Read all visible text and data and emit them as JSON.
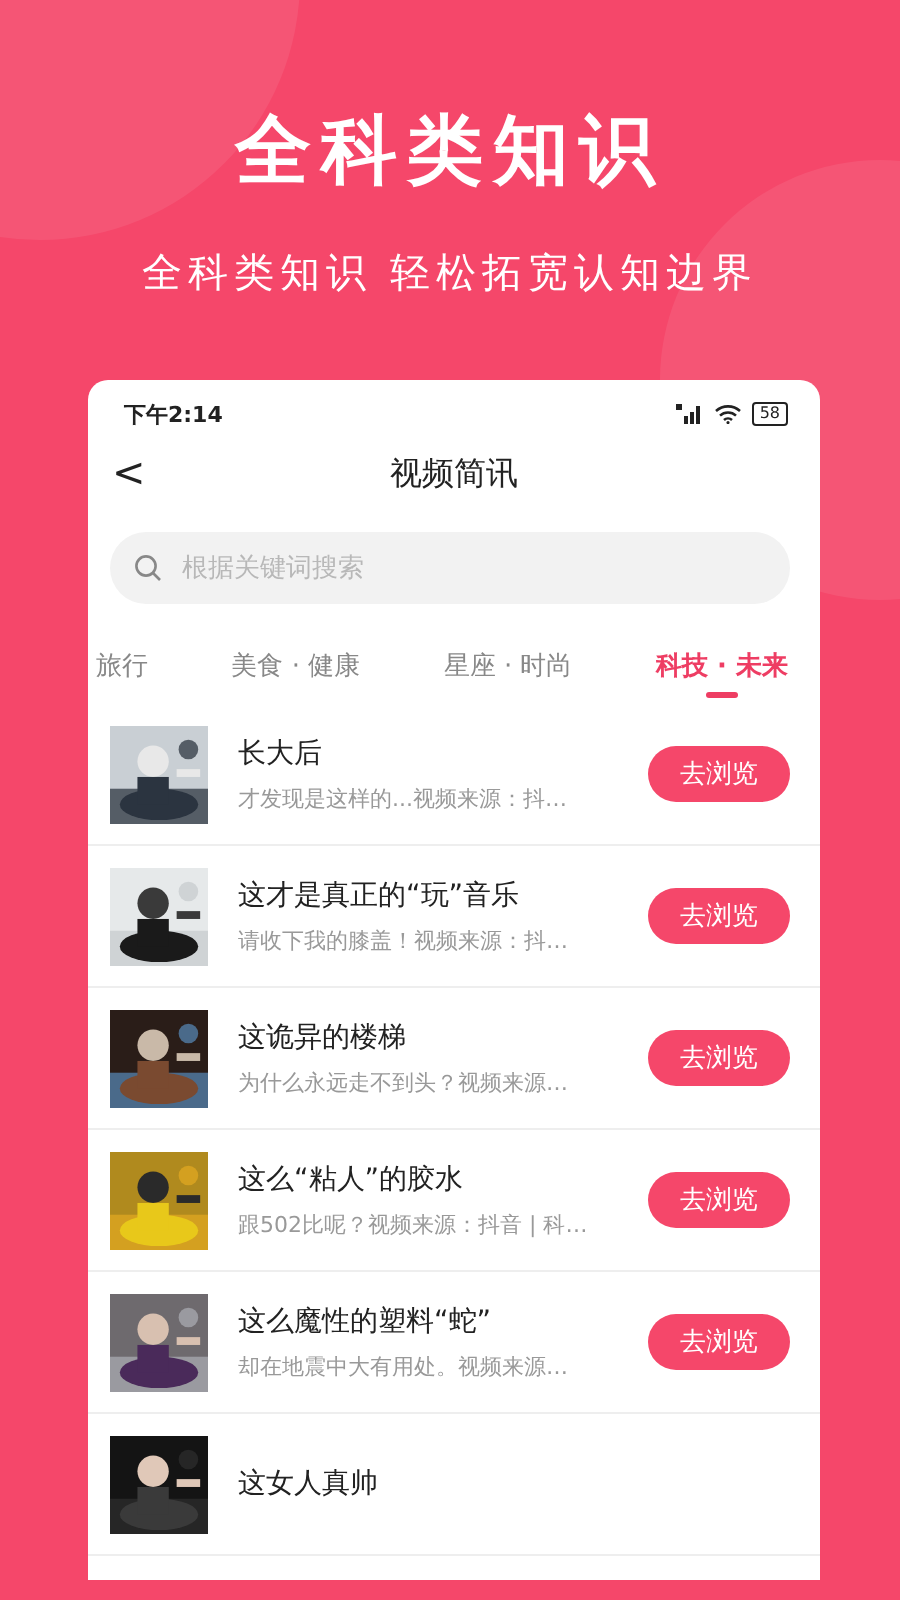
{
  "headline": "全科类知识",
  "tagline": "全科类知识 轻松拓宽认知边界",
  "status_bar": {
    "time": "下午2:14",
    "battery": "58"
  },
  "nav": {
    "back": "<",
    "title": "视频简讯"
  },
  "search": {
    "placeholder": "根据关键词搜索"
  },
  "tabs": [
    {
      "label": "旅行",
      "selected": false
    },
    {
      "label": "美食 · 健康",
      "selected": false
    },
    {
      "label": "星座 · 时尚",
      "selected": false
    },
    {
      "label": "科技 · 未来",
      "selected": true
    }
  ],
  "items": [
    {
      "title": "长大后",
      "subtitle": "才发现是这样的...视频来源：抖…",
      "button": "去浏览"
    },
    {
      "title": "这才是真正的“玩”音乐",
      "subtitle": "请收下我的膝盖！视频来源：抖…",
      "button": "去浏览"
    },
    {
      "title": "这诡异的楼梯",
      "subtitle": "为什么永远走不到头？视频来源…",
      "button": "去浏览"
    },
    {
      "title": "这么“粘人”的胶水",
      "subtitle": "跟502比呢？视频来源：抖音 | 科…",
      "button": "去浏览"
    },
    {
      "title": "这么魔性的塑料“蛇”",
      "subtitle": "却在地震中大有用处。视频来源…",
      "button": "去浏览"
    },
    {
      "title": "这女人真帅"
    }
  ]
}
